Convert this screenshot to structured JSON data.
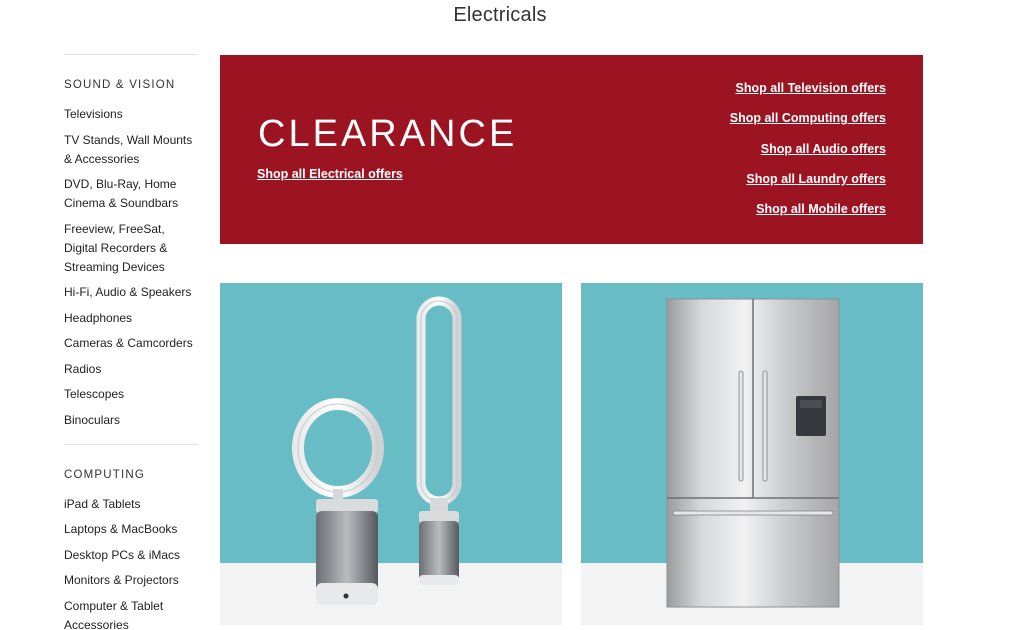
{
  "page": {
    "title": "Electricals"
  },
  "sidebar": {
    "sections": [
      {
        "heading": "SOUND & VISION",
        "items": [
          "Televisions",
          "TV Stands, Wall Mounts & Accessories",
          "DVD, Blu-Ray, Home Cinema & Soundbars",
          "Freeview, FreeSat, Digital Recorders & Streaming Devices",
          "Hi-Fi, Audio & Speakers",
          "Headphones",
          "Cameras & Camcorders",
          "Radios",
          "Telescopes",
          "Binoculars"
        ]
      },
      {
        "heading": "COMPUTING",
        "items": [
          "iPad & Tablets",
          "Laptops & MacBooks",
          "Desktop PCs & iMacs",
          "Monitors & Projectors",
          "Computer & Tablet Accessories"
        ]
      }
    ]
  },
  "banner": {
    "title": "CLEARANCE",
    "main_link": "Shop all Electrical offers",
    "links": [
      "Shop all Television offers",
      "Shop all Computing offers",
      "Shop all Audio offers",
      "Shop all Laundry offers",
      "Shop all Mobile offers"
    ],
    "background": "#9c1422"
  },
  "tiles": [
    {
      "icon": "fan-purifier-image",
      "background": "#67bcc6"
    },
    {
      "icon": "fridge-freezer-image",
      "background": "#67bcc6"
    }
  ]
}
